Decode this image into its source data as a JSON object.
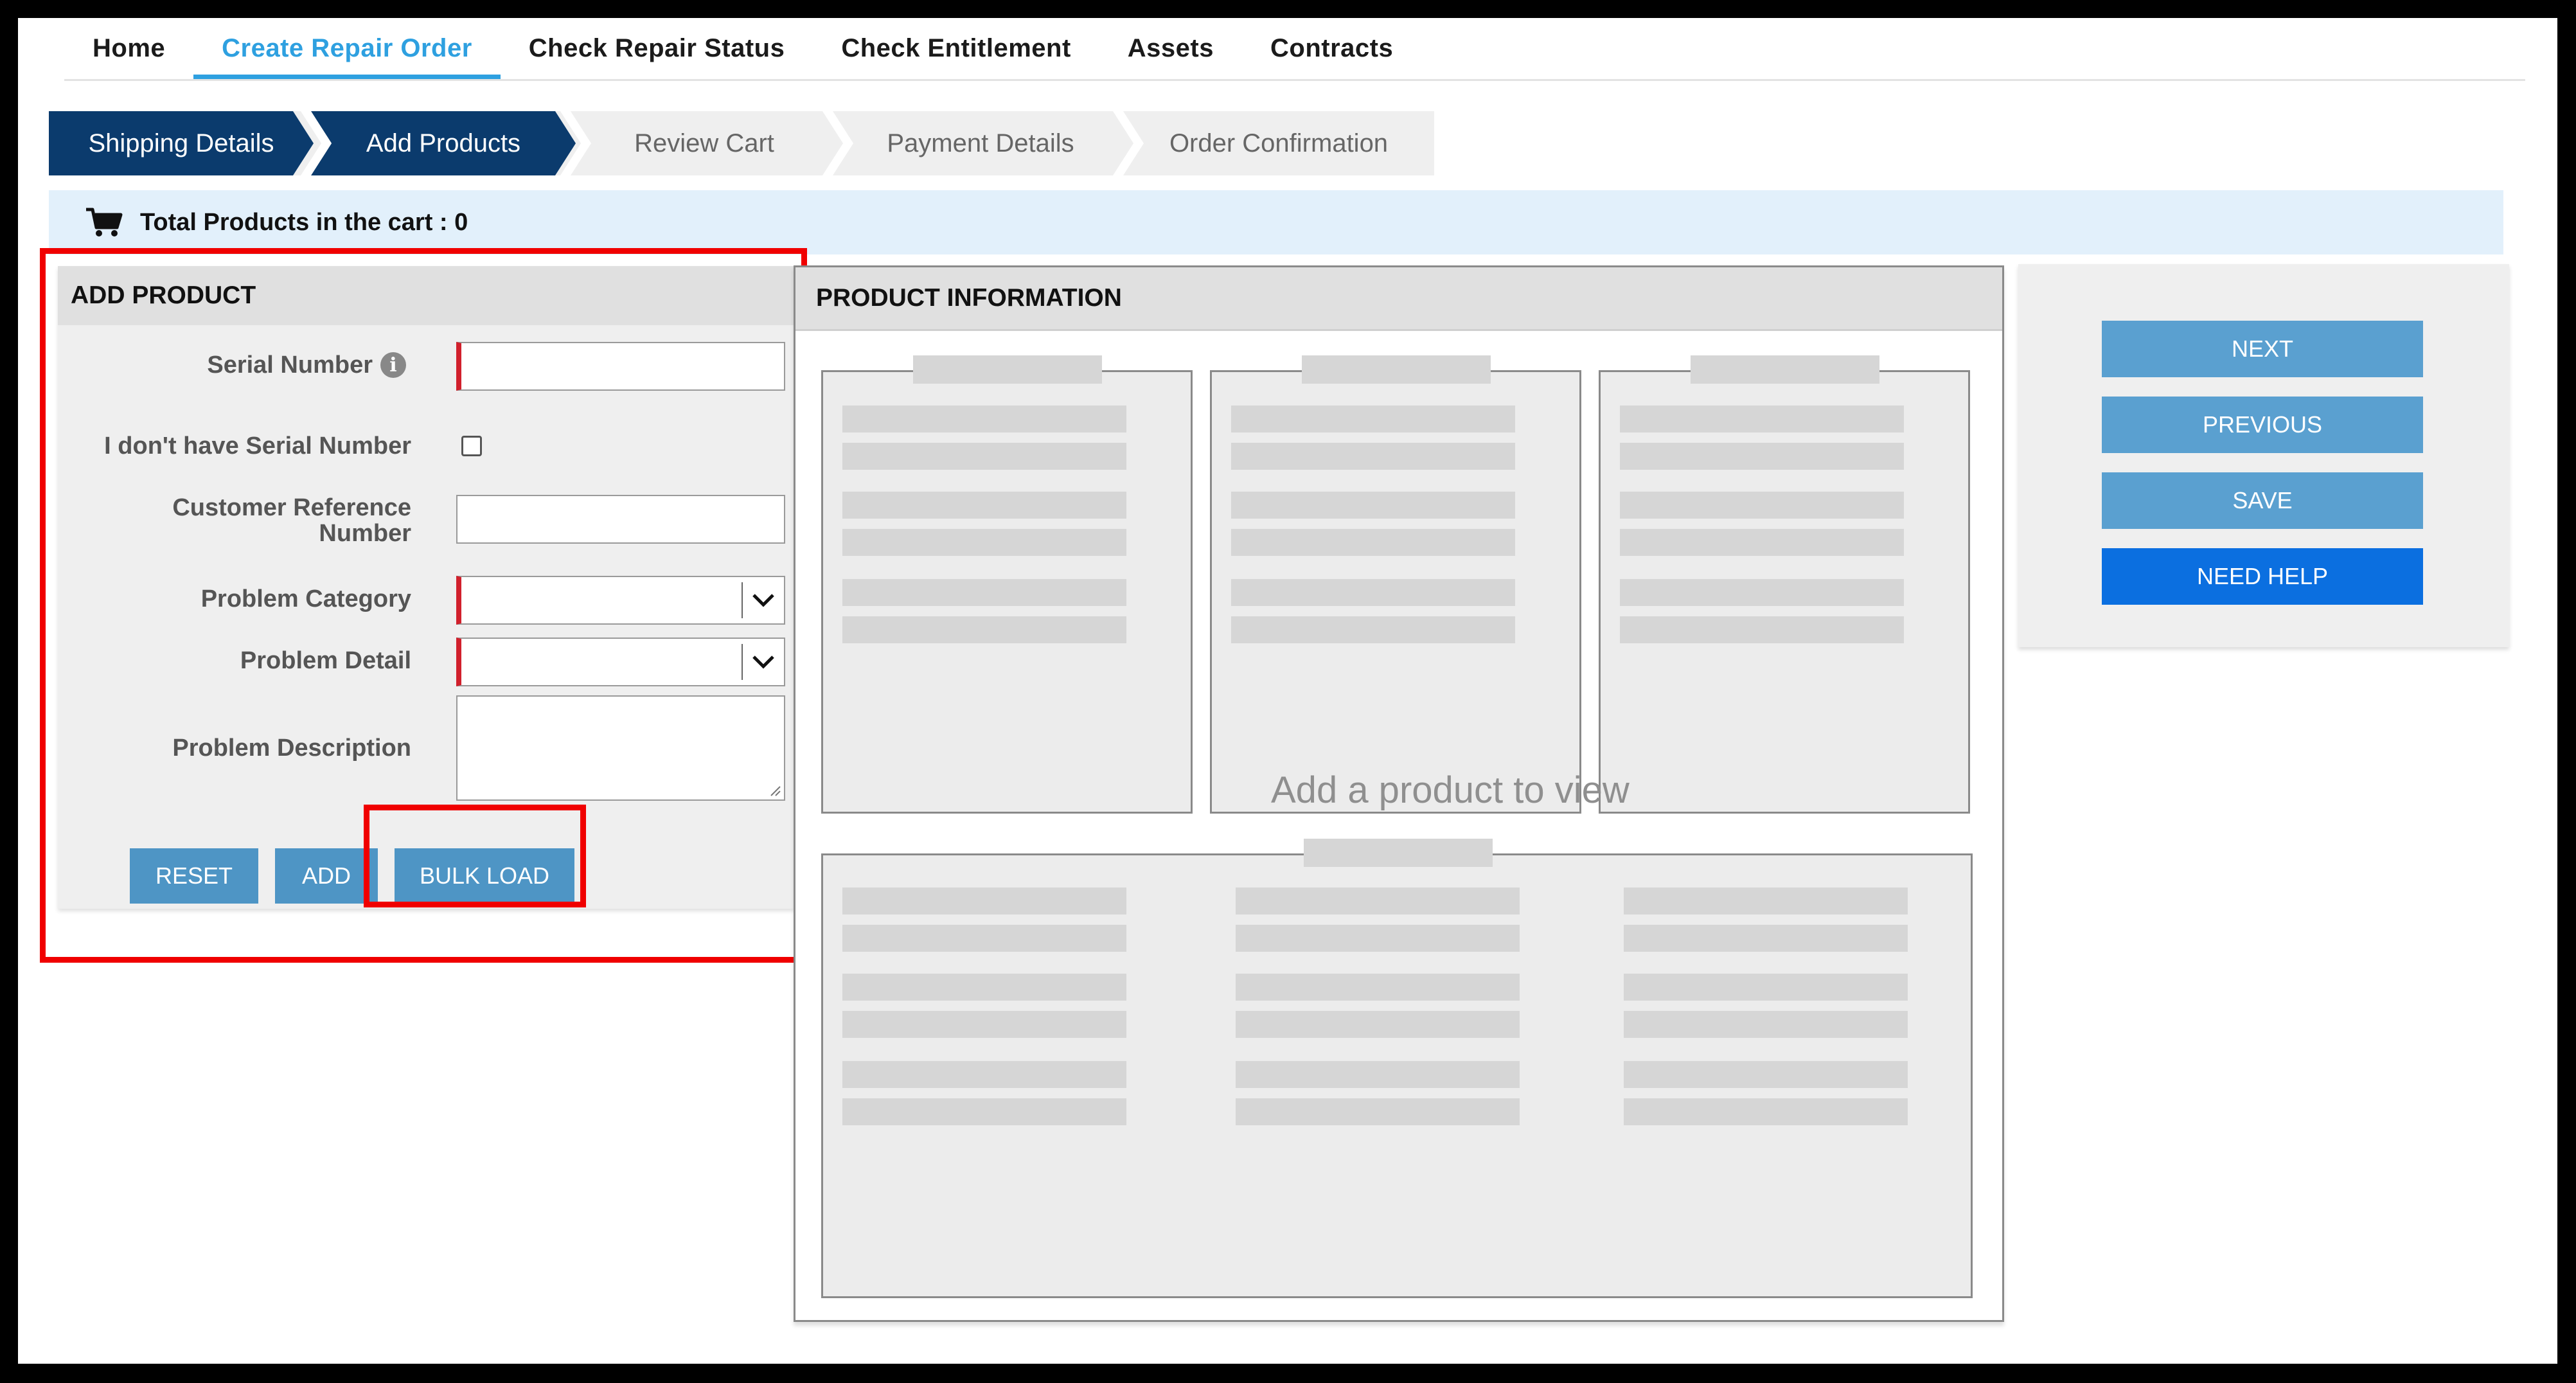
{
  "nav": {
    "items": [
      {
        "label": "Home"
      },
      {
        "label": "Create Repair Order"
      },
      {
        "label": "Check Repair Status"
      },
      {
        "label": "Check Entitlement"
      },
      {
        "label": "Assets"
      },
      {
        "label": "Contracts"
      }
    ],
    "active_index": 1
  },
  "steps": [
    {
      "label": "Shipping Details",
      "state": "complete"
    },
    {
      "label": "Add Products",
      "state": "current"
    },
    {
      "label": "Review Cart",
      "state": "pending"
    },
    {
      "label": "Payment Details",
      "state": "pending"
    },
    {
      "label": "Order Confirmation",
      "state": "pending"
    }
  ],
  "cart": {
    "icon": "shopping-cart-icon",
    "text": "Total Products in the cart : 0"
  },
  "add_product": {
    "title": "ADD PRODUCT",
    "serial_number": {
      "label": "Serial Number",
      "value": "",
      "icon": "info-icon",
      "info_glyph": "i"
    },
    "no_serial": {
      "label": "I don't have Serial Number",
      "checked": false
    },
    "customer_reference": {
      "label_line1": "Customer Reference",
      "label_line2": "Number",
      "value": ""
    },
    "problem_category": {
      "label": "Problem Category",
      "selected": ""
    },
    "problem_detail": {
      "label": "Problem Detail",
      "selected": ""
    },
    "problem_description": {
      "label": "Problem Description",
      "value": ""
    },
    "buttons": {
      "reset": "RESET",
      "add": "ADD",
      "bulk_load": "BULK LOAD"
    }
  },
  "product_information": {
    "title": "PRODUCT INFORMATION",
    "empty_message": "Add a product to view"
  },
  "actions": {
    "next": "NEXT",
    "previous": "PREVIOUS",
    "save": "SAVE",
    "need_help": "NEED HELP"
  },
  "colors": {
    "nav_active": "#2ea0e0",
    "step_complete": "#0b3b6d",
    "button": "#5aa0d0",
    "help_button": "#0b6fe0",
    "required_marker": "#d1202c",
    "highlight_box": "#f00000",
    "cart_bar": "#e2f0fb"
  }
}
